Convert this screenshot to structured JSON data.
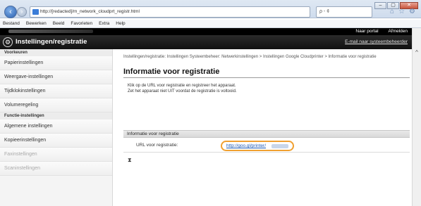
{
  "browser": {
    "address": "http://[redacted]/m_network_cloudprt_registr.html",
    "search": "ρ - ¢",
    "window_buttons": [
      "–",
      "▢",
      "✕"
    ]
  },
  "menubar": {
    "items": [
      "Bestand",
      "Bewerken",
      "Beeld",
      "Favorieten",
      "Extra",
      "Help"
    ]
  },
  "app": {
    "top_links": [
      "Naar portal",
      "Afmelden"
    ],
    "title": "Instellingen/registratie",
    "admin_link": "E-mail naar systeembeheerder"
  },
  "sidebar": {
    "section_preferences": "Voorkeuren",
    "preferences": [
      "Papierinstellingen",
      "Weergave-instellingen",
      "Tijdklokinstellingen",
      "Volumeregeling"
    ],
    "section_functions": "Functie-instellingen",
    "functions": [
      "Algemene instellingen",
      "Kopieerinstellingen",
      "Faxinstellingen",
      "Scaninstellingen"
    ]
  },
  "main": {
    "breadcrumb": "Instellingen/registratie: Instellingen Systeembeheer: Netwerkinstellingen > Instellingen Google Cloudprinter > Informatie voor registratie",
    "title": "Informatie voor registratie",
    "desc_line1": "Klik op de URL voor registratie en registreer het apparaat.",
    "desc_line2": "Zet het apparaat niet UIT voordat de registratie is voltooid.",
    "section": "Informatie voor registratie",
    "url_label": "URL voor registratie:",
    "url_value": "http://goo.gl/printer/",
    "end_mark": "⧗"
  }
}
